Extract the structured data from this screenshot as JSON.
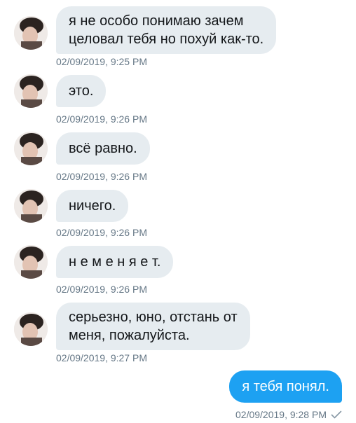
{
  "messages": [
    {
      "lines": [
        "я не особо понимаю зачем",
        "целовал тебя но похуй как-то."
      ],
      "time": "02/09/2019, 9:25 PM"
    },
    {
      "lines": [
        "это."
      ],
      "time": "02/09/2019, 9:26 PM"
    },
    {
      "lines": [
        "всё равно."
      ],
      "time": "02/09/2019, 9:26 PM"
    },
    {
      "lines": [
        "ничего."
      ],
      "time": "02/09/2019, 9:26 PM"
    },
    {
      "lines": [
        "н е м е н я е т."
      ],
      "time": "02/09/2019, 9:26 PM"
    },
    {
      "lines": [
        "серьезно, юно, отстань от",
        "меня, пожалуйста."
      ],
      "time": "02/09/2019, 9:27 PM"
    }
  ],
  "outgoing": {
    "text": "я тебя понял.",
    "time": "02/09/2019, 9:28 PM",
    "status_icon": "check-icon"
  },
  "colors": {
    "incoming_bubble": "#e6ecf0",
    "outgoing_bubble": "#1da1f2",
    "timestamp": "#657786"
  },
  "avatar_icon": "avatar"
}
